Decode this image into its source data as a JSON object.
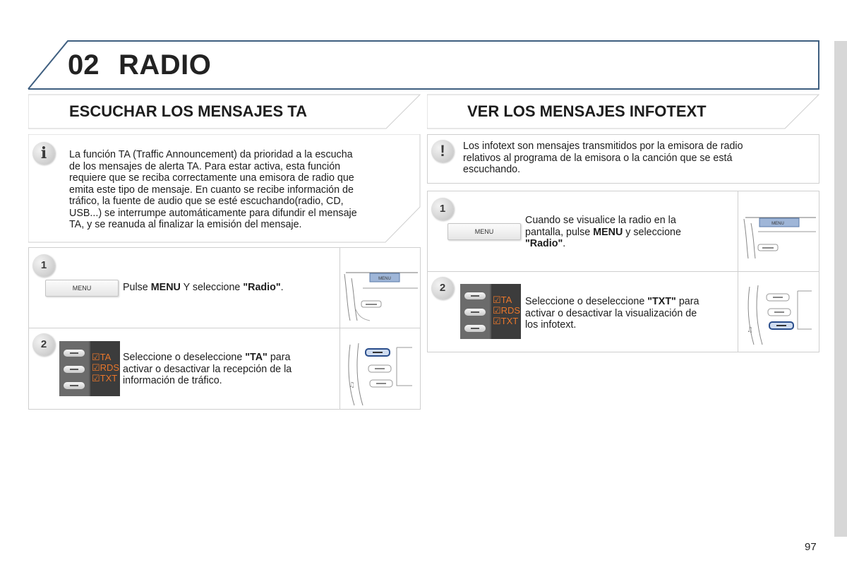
{
  "chapter": {
    "number": "02",
    "title": "RADIO"
  },
  "left": {
    "heading": "ESCUCHAR LOS MENSAJES TA",
    "note_icon": "info-icon",
    "note_lines": [
      "La función TA (Traffic Announcement) da prioridad a la escucha",
      "de los mensajes de alerta TA. Para estar activa, esta función",
      "requiere que se reciba correctamente una emisora de radio que",
      "emita este tipo de mensaje. En cuanto se recibe información de",
      "tráfico, la fuente de audio que se esté escuchando(radio, CD,",
      "USB...) se interrumpe automáticamente para difundir el mensaje",
      "TA, y se reanuda al finalizar la emisión del mensaje."
    ],
    "step1": {
      "num": "1",
      "menu_label": "MENU",
      "screen_menu_label": "MENU",
      "text_a": "Pulse ",
      "text_b": "MENU",
      "text_c": " Y seleccione ",
      "text_d": "\"Radio\"",
      "text_e": "."
    },
    "step2": {
      "num": "2",
      "options": [
        "TA",
        "RDS",
        "TXT"
      ],
      "line1_a": "Seleccione o deseleccione ",
      "line1_b": "\"TA\"",
      "line1_c": " para",
      "line2": "activar o desactivar la recepción de la",
      "line3": "información de tráfico."
    }
  },
  "right": {
    "heading": "VER LOS MENSAJES INFOTEXT",
    "note_icon": "warning-icon",
    "note_lines": [
      "Los infotext son mensajes transmitidos por la emisora de radio",
      "relativos al programa de la emisora o la canción que se está",
      "escuchando."
    ],
    "step1": {
      "num": "1",
      "menu_label": "MENU",
      "screen_menu_label": "MENU",
      "line1": "Cuando se visualice la radio en la",
      "line2_a": "pantalla, pulse ",
      "line2_b": "MENU",
      "line2_c": " y seleccione",
      "line3_a": "\"Radio\"",
      "line3_b": "."
    },
    "step2": {
      "num": "2",
      "options": [
        "TA",
        "RDS",
        "TXT"
      ],
      "line1_a": "Seleccione o deseleccione ",
      "line1_b": "\"TXT\"",
      "line1_c": " para",
      "line2": "activar o desactivar la visualización de",
      "line3": "los infotext."
    }
  },
  "page_number": "97",
  "colors": {
    "header_frame": "#3f5f80",
    "option_text": "#e8762b",
    "highlight_blue": "#9fb6d8"
  }
}
